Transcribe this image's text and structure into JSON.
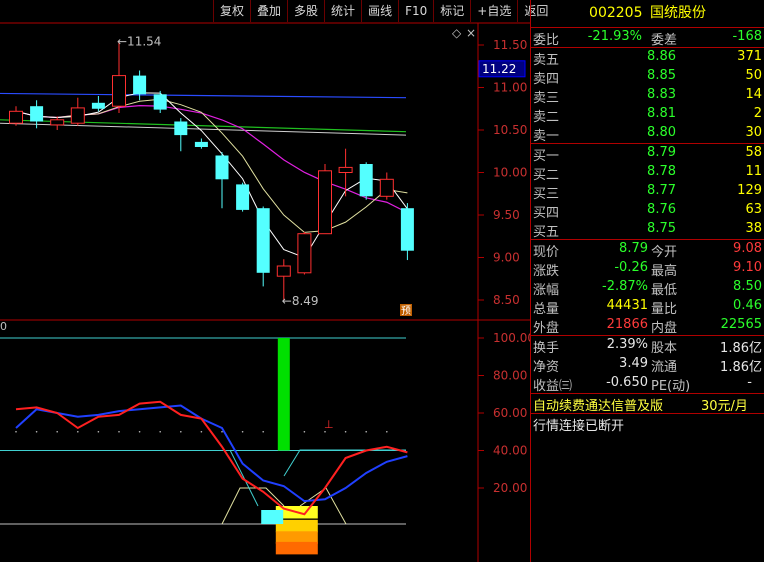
{
  "toolbar": [
    "复权",
    "叠加",
    "多股",
    "统计",
    "画线",
    "F10",
    "标记",
    "+自选",
    "返回"
  ],
  "stock": {
    "code": "002205",
    "name": "国统股份"
  },
  "weibi": {
    "label1": "委比",
    "value1": "-21.93%",
    "label2": "委差",
    "value2": "-168"
  },
  "sell": [
    {
      "label": "卖五",
      "price": "8.86",
      "vol": "371"
    },
    {
      "label": "卖四",
      "price": "8.85",
      "vol": "50"
    },
    {
      "label": "卖三",
      "price": "8.83",
      "vol": "14"
    },
    {
      "label": "卖二",
      "price": "8.81",
      "vol": "2"
    },
    {
      "label": "卖一",
      "price": "8.80",
      "vol": "30"
    }
  ],
  "buy": [
    {
      "label": "买一",
      "price": "8.79",
      "vol": "58"
    },
    {
      "label": "买二",
      "price": "8.78",
      "vol": "11"
    },
    {
      "label": "买三",
      "price": "8.77",
      "vol": "129"
    },
    {
      "label": "买四",
      "price": "8.76",
      "vol": "63"
    },
    {
      "label": "买五",
      "price": "8.75",
      "vol": "38"
    }
  ],
  "quote": {
    "xianjia_l": "现价",
    "xianjia": "8.79",
    "jinkai_l": "今开",
    "jinkai": "9.08",
    "zhangdie_l": "涨跌",
    "zhangdie": "-0.26",
    "zuigao_l": "最高",
    "zuigao": "9.10",
    "zhangfu_l": "涨幅",
    "zhangfu": "-2.87%",
    "zuidi_l": "最低",
    "zuidi": "8.50",
    "zongliang_l": "总量",
    "zongliang": "44431",
    "liangbi_l": "量比",
    "liangbi": "0.46",
    "waipan_l": "外盘",
    "waipan": "21866",
    "neipan_l": "内盘",
    "neipan": "22565"
  },
  "fund": {
    "huanshou_l": "换手",
    "huanshou": "2.39%",
    "guben_l": "股本",
    "guben": "1.86亿",
    "jingzi_l": "净资",
    "jingzi": "3.49",
    "liutong_l": "流通",
    "liutong": "1.86亿",
    "shouyi_l": "收益㈢",
    "shouyi": "-0.650",
    "pe_l": "PE(动)",
    "pe": "-"
  },
  "promo": "自动续费通达信普及版",
  "promo_price": "30元/月",
  "status": "行情连接已断开",
  "chart": {
    "price_ticks": [
      "11.50",
      "11.00",
      "10.50",
      "10.00",
      "9.50",
      "9.00",
      "8.50"
    ],
    "current_price_label": "11.22",
    "high_label": "11.54",
    "low_label": "8.49",
    "yu_marker": "预",
    "osc_ticks": [
      "100.00",
      "80.00",
      "60.00",
      "40.00",
      "20.00"
    ],
    "osc_corner": "0",
    "candles": [
      {
        "open": 10.58,
        "close": 10.72,
        "high": 10.78,
        "low": 10.55
      },
      {
        "open": 10.78,
        "close": 10.6,
        "high": 10.85,
        "low": 10.52
      },
      {
        "open": 10.56,
        "close": 10.62,
        "high": 10.66,
        "low": 10.5
      },
      {
        "open": 10.58,
        "close": 10.76,
        "high": 10.88,
        "low": 10.55
      },
      {
        "open": 10.82,
        "close": 10.75,
        "high": 10.9,
        "low": 10.72
      },
      {
        "open": 10.78,
        "close": 11.14,
        "high": 11.54,
        "low": 10.7
      },
      {
        "open": 11.14,
        "close": 10.92,
        "high": 11.2,
        "low": 10.85
      },
      {
        "open": 10.92,
        "close": 10.74,
        "high": 10.96,
        "low": 10.7
      },
      {
        "open": 10.6,
        "close": 10.44,
        "high": 10.64,
        "low": 10.25
      },
      {
        "open": 10.36,
        "close": 10.3,
        "high": 10.4,
        "low": 10.28
      },
      {
        "open": 10.2,
        "close": 9.92,
        "high": 10.24,
        "low": 9.58
      },
      {
        "open": 9.86,
        "close": 9.56,
        "high": 9.88,
        "low": 9.54
      },
      {
        "open": 9.58,
        "close": 8.82,
        "high": 9.6,
        "low": 8.66
      },
      {
        "open": 8.78,
        "close": 8.9,
        "high": 8.98,
        "low": 8.49
      },
      {
        "open": 8.82,
        "close": 9.28,
        "high": 9.3,
        "low": 8.8
      },
      {
        "open": 9.28,
        "close": 10.02,
        "high": 10.1,
        "low": 9.28
      },
      {
        "open": 10.0,
        "close": 10.06,
        "high": 10.28,
        "low": 9.72
      },
      {
        "open": 10.1,
        "close": 9.72,
        "high": 10.12,
        "low": 9.68
      },
      {
        "open": 9.72,
        "close": 9.92,
        "high": 10.0,
        "low": 9.68
      },
      {
        "open": 9.58,
        "close": 9.08,
        "high": 9.64,
        "low": 8.97
      }
    ],
    "red_line": [
      62,
      63,
      60,
      52,
      58,
      59,
      65,
      66,
      59,
      57,
      42,
      25,
      18,
      9,
      6,
      20,
      36,
      40,
      42,
      39
    ],
    "blue_line": [
      52,
      62,
      60,
      58,
      59,
      61,
      62,
      63,
      64,
      57,
      52,
      33,
      24,
      21,
      13,
      14,
      20,
      28,
      34,
      37
    ],
    "green_bar": [
      100,
      40
    ],
    "highlight_bars": [
      12,
      0
    ]
  }
}
